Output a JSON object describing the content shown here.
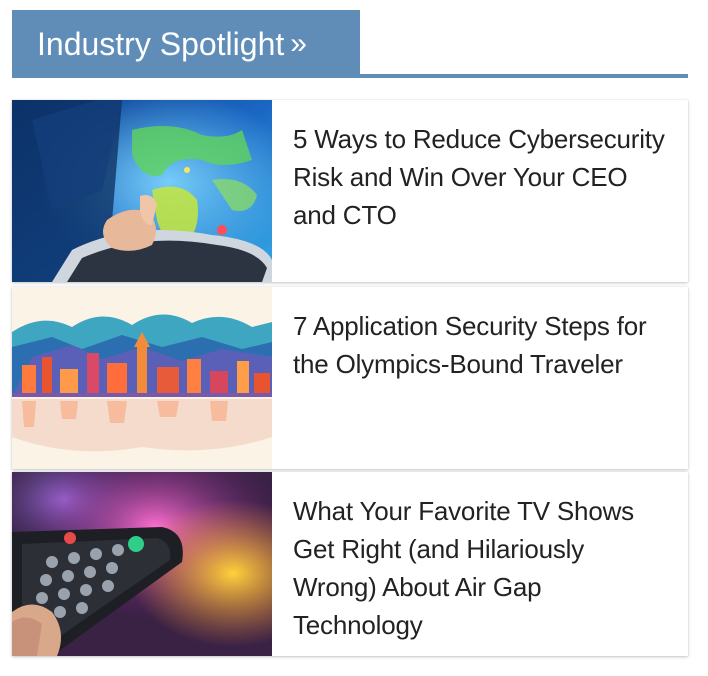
{
  "section": {
    "title": "Industry Spotlight",
    "chevron": "»"
  },
  "articles": [
    {
      "title": "5 Ways to Reduce Cybersecurity Risk and Win Over Your CEO and CTO",
      "image": "tablet-world-map-image"
    },
    {
      "title": "7 Application Security Steps for the Olympics-Bound Traveler",
      "image": "city-skyline-illustration-image"
    },
    {
      "title": "What Your Favorite TV Shows Get Right (and Hilariously Wrong) About Air Gap Technology",
      "image": "tv-remote-image"
    }
  ],
  "colors": {
    "accent": "#5f8db8",
    "text": "#222222"
  }
}
